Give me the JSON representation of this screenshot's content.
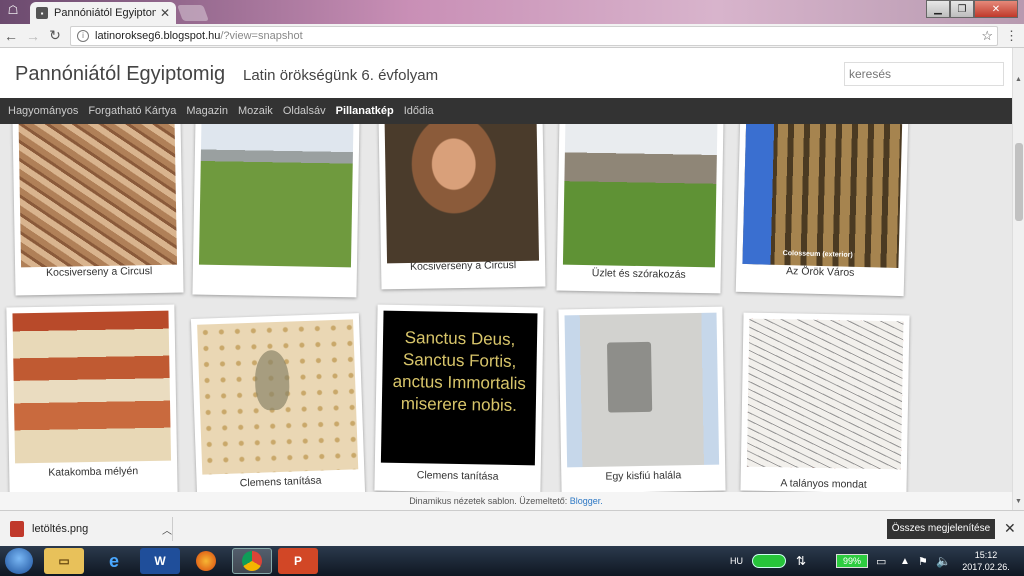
{
  "browser": {
    "tab_title": "Pannóniától Egyiptomig",
    "url_host": "latinorokseg6.blogspot.hu",
    "url_path": "/?view=snapshot",
    "icons": [
      "menu-icon",
      "back-icon",
      "forward-icon",
      "reload-icon",
      "info-icon",
      "star-icon",
      "kebab-icon"
    ]
  },
  "blog": {
    "title": "Pannóniától Egyiptomig",
    "description": "Latin örökségünk 6. évfolyam",
    "search_placeholder": "keresés",
    "nav": [
      "Hagyományos",
      "Forgatható Kártya",
      "Magazin",
      "Mozaik",
      "Oldalsáv",
      "Pillanatkép",
      "Idődia"
    ],
    "active_nav": "Pillanatkép"
  },
  "cards": [
    {
      "caption": "Kocsiverseny a Circusl"
    },
    {
      "caption": ""
    },
    {
      "caption": "Kocsiverseny a Circusl"
    },
    {
      "caption": "Üzlet és szórakozás"
    },
    {
      "caption": "Az Örök Város",
      "overlay": "Colosseum (exterior)"
    },
    {
      "caption": "Katakomba mélyén"
    },
    {
      "caption": "Clemens tanítása"
    },
    {
      "caption": "Clemens tanítása",
      "overlay_lines": [
        "Sanctus Deus,",
        "Sanctus Fortis,",
        "anctus Immortalis",
        "miserere nobis."
      ]
    },
    {
      "caption": "Egy kisfiú halála"
    },
    {
      "caption": "A talányos mondat"
    }
  ],
  "footer": {
    "text": "Dinamikus nézetek sablon. Üzemeltető:",
    "link": "Blogger."
  },
  "download": {
    "file": "letöltés.png",
    "show_all": "Összes megjelenítése"
  },
  "taskbar": {
    "lang": "HU",
    "battery": "99%",
    "time": "15:12",
    "date": "2017.02.26."
  },
  "colors": {
    "nav_bg": "#333333",
    "active_link": "#2d78c4",
    "content_bg": "#e8e8e8"
  }
}
